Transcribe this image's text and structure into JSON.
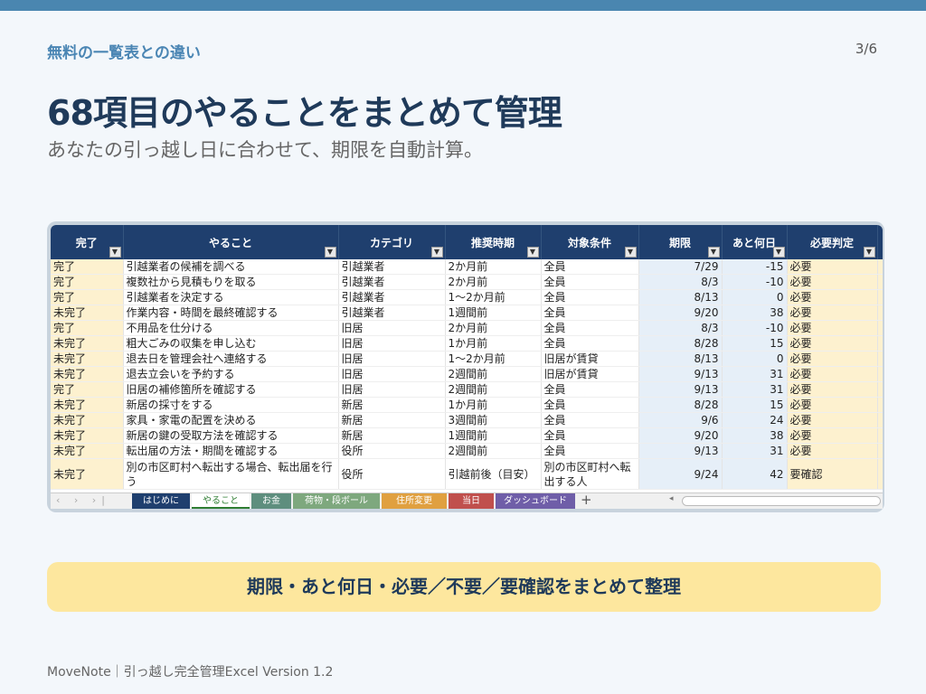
{
  "header": {
    "section_label": "無料の一覧表との違い",
    "page_num": "3/6",
    "title": "68項目のやることをまとめて管理",
    "subtitle": "あなたの引っ越し日に合わせて、期限を自動計算。"
  },
  "colors": {
    "accent": "#4a86b0",
    "header_bg": "#1f3f6e",
    "banner": "#fde79e",
    "highlight": "#fdf1cf"
  },
  "sheet": {
    "columns": [
      "完了",
      "やること",
      "カテゴリ",
      "推奨時期",
      "対象条件",
      "期限",
      "あと何日",
      "必要判定"
    ],
    "rows": [
      [
        "完了",
        "引越業者の候補を調べる",
        "引越業者",
        "2か月前",
        "全員",
        "7/29",
        "-15",
        "必要"
      ],
      [
        "完了",
        "複数社から見積もりを取る",
        "引越業者",
        "2か月前",
        "全員",
        "8/3",
        "-10",
        "必要"
      ],
      [
        "完了",
        "引越業者を決定する",
        "引越業者",
        "1〜2か月前",
        "全員",
        "8/13",
        "0",
        "必要"
      ],
      [
        "未完了",
        "作業内容・時間を最終確認する",
        "引越業者",
        "1週間前",
        "全員",
        "9/20",
        "38",
        "必要"
      ],
      [
        "完了",
        "不用品を仕分ける",
        "旧居",
        "2か月前",
        "全員",
        "8/3",
        "-10",
        "必要"
      ],
      [
        "未完了",
        "粗大ごみの収集を申し込む",
        "旧居",
        "1か月前",
        "全員",
        "8/28",
        "15",
        "必要"
      ],
      [
        "未完了",
        "退去日を管理会社へ連絡する",
        "旧居",
        "1〜2か月前",
        "旧居が賃貸",
        "8/13",
        "0",
        "必要"
      ],
      [
        "未完了",
        "退去立会いを予約する",
        "旧居",
        "2週間前",
        "旧居が賃貸",
        "9/13",
        "31",
        "必要"
      ],
      [
        "完了",
        "旧居の補修箇所を確認する",
        "旧居",
        "2週間前",
        "全員",
        "9/13",
        "31",
        "必要"
      ],
      [
        "未完了",
        "新居の採寸をする",
        "新居",
        "1か月前",
        "全員",
        "8/28",
        "15",
        "必要"
      ],
      [
        "未完了",
        "家具・家電の配置を決める",
        "新居",
        "3週間前",
        "全員",
        "9/6",
        "24",
        "必要"
      ],
      [
        "未完了",
        "新居の鍵の受取方法を確認する",
        "新居",
        "1週間前",
        "全員",
        "9/20",
        "38",
        "必要"
      ],
      [
        "未完了",
        "転出届の方法・期間を確認する",
        "役所",
        "2週間前",
        "全員",
        "9/13",
        "31",
        "必要"
      ],
      [
        "未完了",
        "別の市区町村へ転出する場合、転出届を行う",
        "役所",
        "引越前後（目安）",
        "別の市区町村へ転出する人",
        "9/24",
        "42",
        "要確認"
      ]
    ],
    "tabs": [
      {
        "label": "はじめに",
        "color": "#1f3f6e"
      },
      {
        "label": "やること",
        "color": "#ffffff"
      },
      {
        "label": "お金",
        "color": "#5e8e7e"
      },
      {
        "label": "荷物・段ボール",
        "color": "#7ea87e"
      },
      {
        "label": "住所変更",
        "color": "#e0a040"
      },
      {
        "label": "当日",
        "color": "#c0504d"
      },
      {
        "label": "ダッシュボード",
        "color": "#6f5ea8"
      }
    ]
  },
  "banner": "期限・あと何日・必要／不要／要確認をまとめて整理",
  "footer": "MoveNote｜引っ越し完全管理Excel  Version 1.2"
}
